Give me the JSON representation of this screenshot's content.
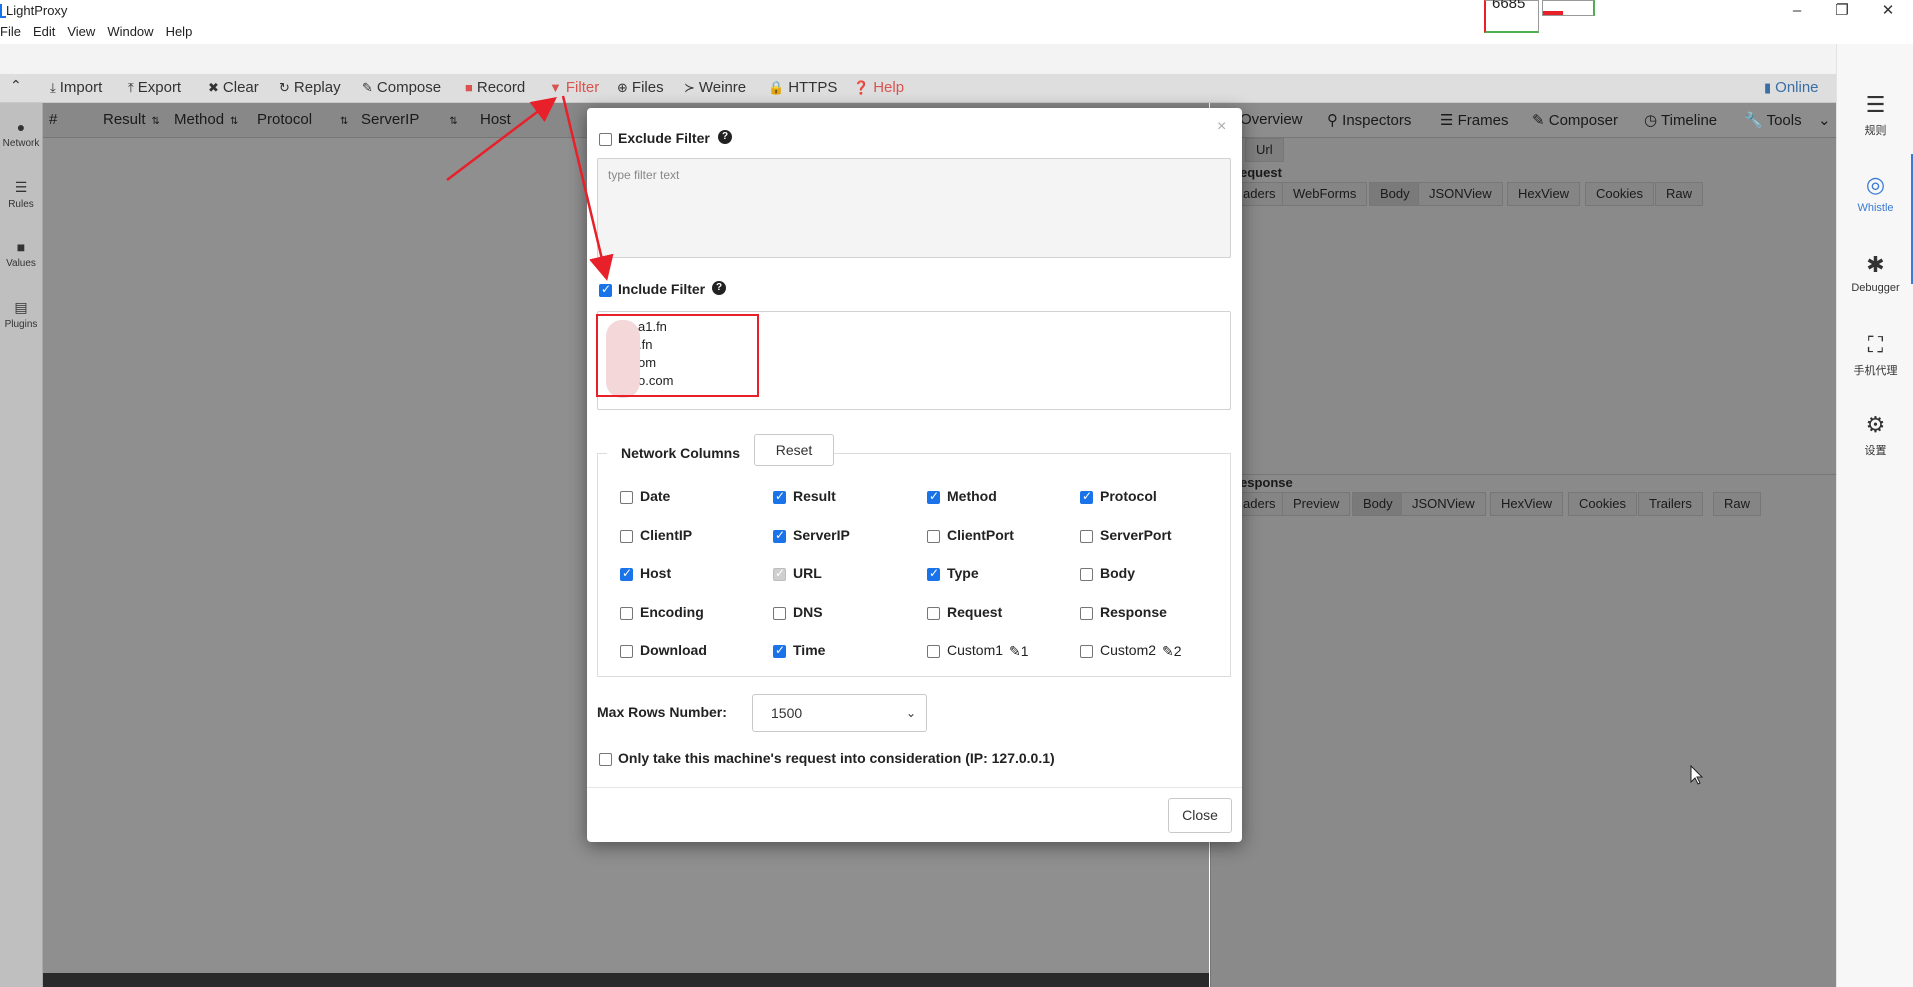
{
  "app": {
    "title": "LightProxy"
  },
  "menu": [
    "File",
    "Edit",
    "View",
    "Window",
    "Help"
  ],
  "titlebar_thumb_text": "6685",
  "toolbar": {
    "items": [
      "Import",
      "Export",
      "Clear",
      "Replay",
      "Compose",
      "Record",
      "Filter",
      "Files",
      "Weinre",
      "HTTPS",
      "Help"
    ],
    "status": "Online"
  },
  "left_sidebar": [
    "Network",
    "Rules",
    "Values",
    "Plugins"
  ],
  "network_columns": [
    "#",
    "Result",
    "Method",
    "Protocol",
    "ServerIP",
    "Host"
  ],
  "detail": {
    "tabs": [
      "Overview",
      "Inspectors",
      "Frames",
      "Composer",
      "Timeline",
      "Tools"
    ],
    "url_tab": "Url",
    "request_label": "equest",
    "request_tabs": [
      "aders",
      "WebForms",
      "Body",
      "JSONView",
      "HexView",
      "Cookies",
      "Raw"
    ],
    "response_label": "esponse",
    "response_tabs": [
      "aders",
      "Preview",
      "Body",
      "JSONView",
      "HexView",
      "Cookies",
      "Trailers",
      "Raw"
    ]
  },
  "right_sidebar": [
    "规则",
    "Whistle",
    "Debugger",
    "手机代理",
    "设置"
  ],
  "modal": {
    "exclude_label": "Exclude Filter",
    "exclude_placeholder": "type filter text",
    "include_label": "Include Filter",
    "include_lines": [
      "a1.fn",
      ".fn",
      "om",
      "o.com"
    ],
    "network_columns_label": "Network Columns",
    "reset_label": "Reset",
    "columns": [
      {
        "label": "Date",
        "checked": false
      },
      {
        "label": "Result",
        "checked": true
      },
      {
        "label": "Method",
        "checked": true
      },
      {
        "label": "Protocol",
        "checked": true
      },
      {
        "label": "ClientIP",
        "checked": false
      },
      {
        "label": "ServerIP",
        "checked": true
      },
      {
        "label": "ClientPort",
        "checked": false
      },
      {
        "label": "ServerPort",
        "checked": false
      },
      {
        "label": "Host",
        "checked": true
      },
      {
        "label": "URL",
        "checked": true,
        "disabled": true
      },
      {
        "label": "Type",
        "checked": true
      },
      {
        "label": "Body",
        "checked": false
      },
      {
        "label": "Encoding",
        "checked": false
      },
      {
        "label": "DNS",
        "checked": false
      },
      {
        "label": "Request",
        "checked": false
      },
      {
        "label": "Response",
        "checked": false
      },
      {
        "label": "Download",
        "checked": false
      },
      {
        "label": "Time",
        "checked": true
      },
      {
        "label": "Custom1",
        "checked": false,
        "suffix": "1"
      },
      {
        "label": "Custom2",
        "checked": false,
        "suffix": "2"
      }
    ],
    "max_rows_label": "Max Rows Number:",
    "max_rows_value": "1500",
    "only_machine_label": "Only take this machine's request into consideration (IP: 127.0.0.1)",
    "close_label": "Close",
    "close_x": "×"
  },
  "colors": {
    "accent": "#1a73e8",
    "annotation": "#e8202a",
    "help_red": "#d9534f"
  },
  "icons": [
    "import-icon",
    "export-icon",
    "clear-icon",
    "replay-icon",
    "compose-icon",
    "record-icon",
    "filter-icon",
    "files-icon",
    "weinre-icon",
    "https-lock-icon",
    "help-icon",
    "chart-icon"
  ]
}
